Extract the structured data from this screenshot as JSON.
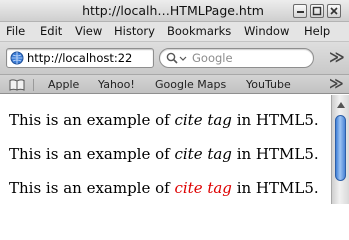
{
  "window": {
    "title": "http://localh…HTMLPage.htm"
  },
  "menubar": {
    "items": [
      {
        "label": "File"
      },
      {
        "label": "Edit"
      },
      {
        "label": "View"
      },
      {
        "label": "History"
      },
      {
        "label": "Bookmarks"
      },
      {
        "label": "Window"
      },
      {
        "label": "Help"
      }
    ]
  },
  "toolbar": {
    "url": "http://localhost:22",
    "search_placeholder": "Google",
    "overflow_label": "≫"
  },
  "bookmarks": {
    "items": [
      {
        "label": "Apple"
      },
      {
        "label": "Yahoo!"
      },
      {
        "label": "Google Maps"
      },
      {
        "label": "YouTube"
      }
    ],
    "overflow_label": "≫"
  },
  "content": {
    "lines": [
      {
        "before": "This is an example of ",
        "cite": "cite tag",
        "after": " in HTML5."
      },
      {
        "before": "This is an example of ",
        "cite": "cite tag",
        "after": " in HTML5."
      },
      {
        "before": "This is an example of ",
        "cite": "cite tag",
        "after": " in HTML5."
      }
    ]
  },
  "colors": {
    "highlight_cite": "#dd0000",
    "scroll_thumb": "#5b93dd"
  }
}
